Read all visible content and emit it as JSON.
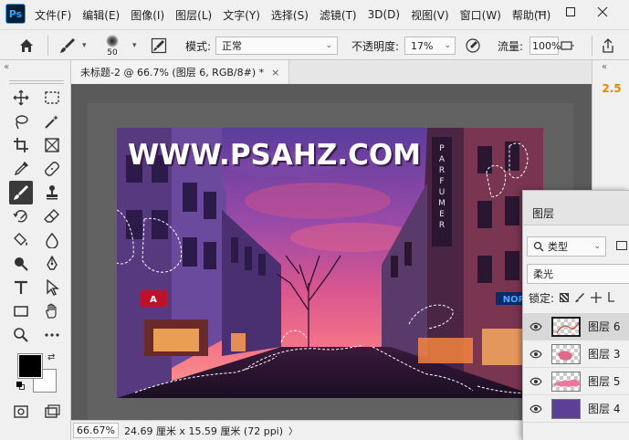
{
  "app": {
    "logo": "Ps"
  },
  "menu": [
    "文件(F)",
    "编辑(E)",
    "图像(I)",
    "图层(L)",
    "文字(Y)",
    "选择(S)",
    "滤镜(T)",
    "3D(D)",
    "视图(V)",
    "窗口(W)",
    "帮助(H)"
  ],
  "options": {
    "brush_size": "50",
    "mode_label": "模式:",
    "mode_value": "正常",
    "opacity_label": "不透明度:",
    "opacity_value": "17%",
    "flow_label": "流量:",
    "flow_value": "100%"
  },
  "document": {
    "tab_title": "未标题-2 @ 66.7% (图层 6, RGB/8#) *",
    "close_label": "×",
    "watermark": "WWW.PSAHZ.COM"
  },
  "status": {
    "zoom": "66.67%",
    "info": "24.69 厘米 x 15.59 厘米 (72 ppi)",
    "arrow": "〉"
  },
  "right_dock": {
    "value": "2.5"
  },
  "layers_panel": {
    "title": "图层",
    "filter_label": "类型",
    "blend_mode": "柔光",
    "lock_label": "锁定:",
    "layers": [
      {
        "name": "图层 6",
        "selected": true,
        "thumb": "transparent-sketch"
      },
      {
        "name": "图层 3",
        "selected": false,
        "thumb": "transparent-pink"
      },
      {
        "name": "图层 5",
        "selected": false,
        "thumb": "transparent-pink-strip"
      },
      {
        "name": "图层 4",
        "selected": false,
        "thumb": "solid",
        "color": "#5e3f98"
      }
    ]
  },
  "colors": {
    "foreground": "#000000",
    "background": "#ffffff",
    "accent_orange": "#e58a00"
  },
  "icons": {
    "tools": [
      "move-icon",
      "marquee-icon",
      "lasso-icon",
      "magic-wand-icon",
      "crop-icon",
      "frame-icon",
      "eyedropper-icon",
      "healing-icon",
      "brush-icon",
      "stamp-icon",
      "history-brush-icon",
      "eraser-icon",
      "bucket-icon",
      "blur-icon",
      "dodge-icon",
      "pen-icon",
      "type-icon",
      "path-select-icon",
      "rectangle-icon",
      "hand-icon",
      "zoom-icon",
      "more-icon"
    ]
  }
}
